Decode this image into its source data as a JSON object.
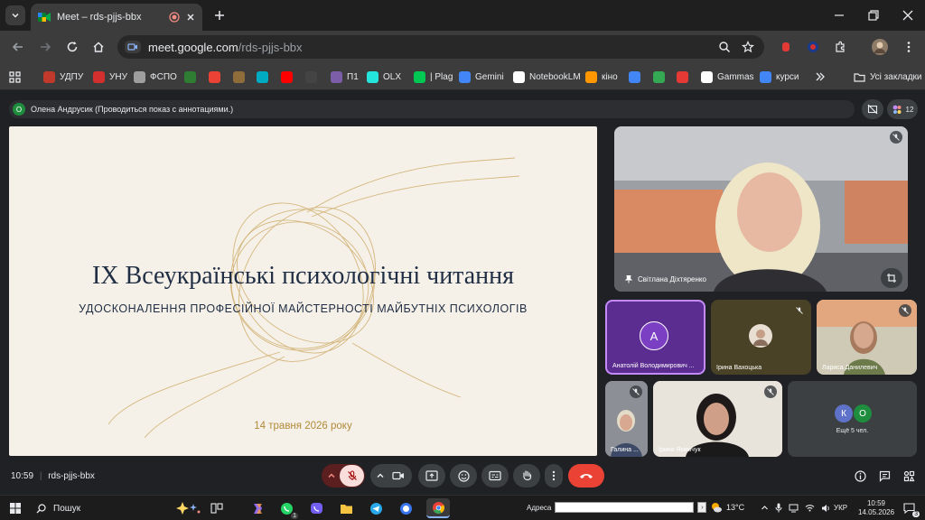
{
  "browser": {
    "tab_title": "Meet – rds-pjjs-bbx",
    "url_host": "meet.google.com",
    "url_path": "/rds-pjjs-bbx"
  },
  "bookmarks": [
    {
      "label": "УДПУ",
      "color": "#c0392b"
    },
    {
      "label": "УНУ",
      "color": "#d32f2f"
    },
    {
      "label": "ФСПО",
      "color": "#9e9e9e"
    },
    {
      "label": "",
      "color": "#2e7d32"
    },
    {
      "label": "",
      "color": "#ea4335"
    },
    {
      "label": "",
      "color": "#8e6d3a"
    },
    {
      "label": "",
      "color": "#00acc1"
    },
    {
      "label": "",
      "color": "#ff0000"
    },
    {
      "label": "",
      "color": "#444444"
    },
    {
      "label": "П1",
      "color": "#7b5ea7"
    },
    {
      "label": "OLX",
      "color": "#23e5db"
    },
    {
      "label": "| Plag",
      "color": "#00c853"
    },
    {
      "label": "Gemini",
      "color": "#4285f4"
    },
    {
      "label": "NotebookLM",
      "color": "#ffffff"
    },
    {
      "label": "кіно",
      "color": "#ff9800"
    },
    {
      "label": "",
      "color": "#4285f4"
    },
    {
      "label": "",
      "color": "#34a853"
    },
    {
      "label": "",
      "color": "#e53935"
    },
    {
      "label": "Gammas",
      "color": "#ffffff"
    },
    {
      "label": "курси",
      "color": "#4285f4"
    }
  ],
  "bookmarks_all": "Усі закладки",
  "meet": {
    "presenter_badge": "О",
    "presenter_text": "Олена Андрусик (Проводиться показ с аннотациями.)",
    "participants_count": "12",
    "meeting_time": "10:59",
    "meeting_code": "rds-pjjs-bbx",
    "slide": {
      "title": "IX Всеукраїнські психологічні читання",
      "subtitle": "УДОСКОНАЛЕННЯ ПРОФЕСІЙНОЇ МАЙСТЕРНОСТІ МАЙБУТНІХ ПСИХОЛОГІВ",
      "date": "14 травня 2026 року"
    },
    "tiles": {
      "main": "Світлана Діхтяренко",
      "t1_initial": "А",
      "t1_name": "Анатолій Володимирович ...",
      "t2_name": "Ірина Вахоцька",
      "t3_name": "Лариса Данилевич",
      "t4_name": "Галина ...",
      "t5_name": "Ірина Якимчук",
      "more_a": "К",
      "more_b": "О",
      "more_text": "Ещё 5 чел."
    }
  },
  "taskbar": {
    "search": "Пошук",
    "address_label": "Адреса",
    "weather": "13°C",
    "lang": "УКР",
    "time": "10:59",
    "date": "14.05.2026",
    "whatsapp_badge": "1",
    "notif_badge": "3"
  },
  "colors": {
    "meet_bg": "#202124",
    "end_call": "#ea4335",
    "active_tile": "#7b3fc4",
    "accent_gold": "#b08a3a"
  }
}
